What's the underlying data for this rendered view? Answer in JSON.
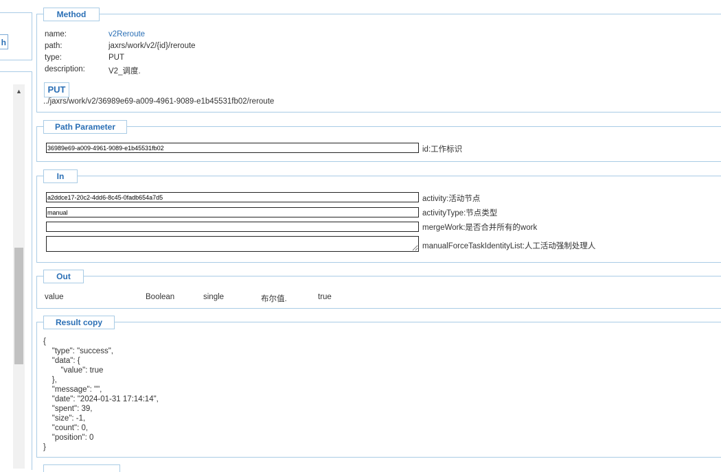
{
  "sidebar": {
    "search_button_label": "h"
  },
  "method": {
    "legend": "Method",
    "fields": [
      {
        "key": "name:",
        "value": "v2Reroute"
      },
      {
        "key": "path:",
        "value": "jaxrs/work/v2/{id}/reroute"
      },
      {
        "key": "type:",
        "value": "PUT"
      },
      {
        "key": "description:",
        "value": "V2_调度."
      }
    ],
    "put_button": "PUT",
    "url": "../jaxrs/work/v2/36989e69-a009-4961-9089-e1b45531fb02/reroute"
  },
  "path_parameter": {
    "legend": "Path Parameter",
    "id_value": "36989e69-a009-4961-9089-e1b45531fb02",
    "id_label": "id:工作标识"
  },
  "in": {
    "legend": "In",
    "activity_value": "a2ddce17-20c2-4dd6-8c45-0fadb654a7d5",
    "activity_label": "activity:活动节点",
    "activityType_value": "manual",
    "activityType_label": "activityType:节点类型",
    "mergeWork_value": "",
    "mergeWork_label": "mergeWork:是否合并所有的work",
    "manualForceTaskIdentityList_value": "",
    "manualForceTaskIdentityList_label": "manualForceTaskIdentityList:人工活动强制处理人"
  },
  "out": {
    "legend": "Out",
    "row": {
      "name": "value",
      "type": "Boolean",
      "mode": "single",
      "desc": "布尔值.",
      "value": "true"
    }
  },
  "result": {
    "legend": "Result copy",
    "json": "{\n    \"type\": \"success\",\n    \"data\": {\n        \"value\": true\n    },\n    \"message\": \"\",\n    \"date\": \"2024-01-31 17:14:14\",\n    \"spent\": 39,\n    \"size\": -1,\n    \"count\": 0,\n    \"position\": 0\n}"
  }
}
